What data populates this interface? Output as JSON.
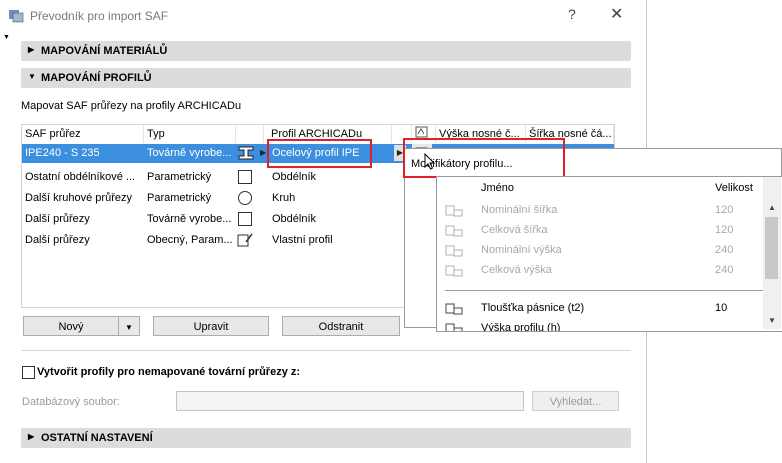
{
  "window": {
    "title": "Převodník pro import SAF",
    "help": "?",
    "close": "✕"
  },
  "sections": {
    "materials": "MAPOVÁNÍ MATERIÁLŮ",
    "profiles": "MAPOVÁNÍ PROFILŮ",
    "other": "OSTATNÍ NASTAVENÍ"
  },
  "profiles": {
    "subtitle": "Mapovat SAF průřezy na profily ARCHICADu",
    "columns": [
      "SAF průřez",
      "Typ",
      "Profil ARCHICADu",
      "Výška nosné č...",
      "Šířka nosné čá..."
    ],
    "selected_row": {
      "saf": "IPE240 - S 235",
      "type": "Továrně vyrobe...",
      "profile": "Ocelový profil IPE"
    },
    "rows": [
      {
        "saf": "Ostatní obdélníkové ...",
        "type": "Parametrický",
        "profile": "Obdélník",
        "shape": "square"
      },
      {
        "saf": "Další kruhové průřezy",
        "type": "Parametrický",
        "profile": "Kruh",
        "shape": "circle"
      },
      {
        "saf": "Další průřezy",
        "type": "Továrně vyrobe...",
        "profile": "Obdélník",
        "shape": "square"
      },
      {
        "saf": "Další průřezy",
        "type": "Obecný, Param...",
        "profile": "Vlastní profil",
        "shape": "custom"
      }
    ],
    "buttons": {
      "new": "Nový",
      "edit": "Upravit",
      "remove": "Odstranit"
    }
  },
  "create_profiles": {
    "checkbox_label": "Vytvořit profily pro nemapované tovární průřezy z:",
    "checked": false,
    "db_label": "Databázový soubor:",
    "db_value": "",
    "browse": "Vyhledat..."
  },
  "popup": {
    "menu_item": "Modifikátory profilu...",
    "col_name": "Jméno",
    "col_size": "Velikost",
    "rows": [
      {
        "name": "Nominální šířka",
        "size": "120",
        "enabled": false
      },
      {
        "name": "Celková šířka",
        "size": "120",
        "enabled": false
      },
      {
        "name": "Nominální výška",
        "size": "240",
        "enabled": false
      },
      {
        "name": "Celková výška",
        "size": "240",
        "enabled": false
      },
      {
        "name": "Tloušťka pásnice (t2)",
        "size": "10",
        "enabled": true
      },
      {
        "name": "Výška profilu (h)",
        "size": "",
        "enabled": true
      }
    ]
  },
  "colors": {
    "selection": "#3b8fde",
    "highlight": "#e0202a",
    "section_bg": "#dcdcdc"
  }
}
